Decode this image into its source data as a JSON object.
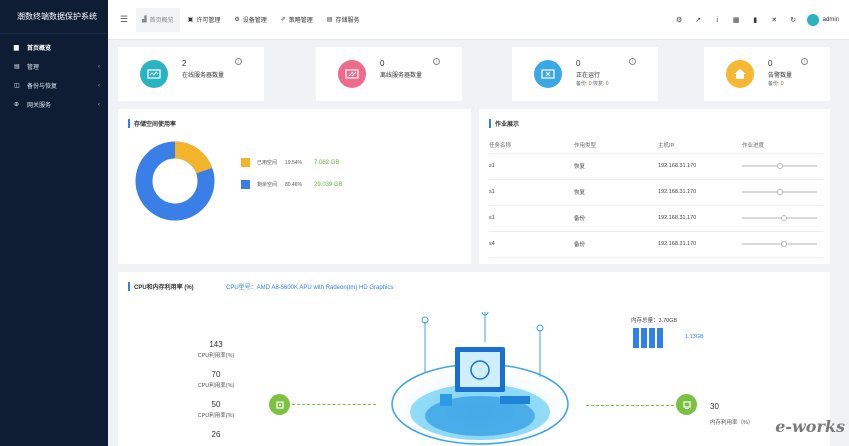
{
  "app": {
    "title": "潮数终端数据保护系统"
  },
  "sidebar": {
    "items": [
      {
        "icon": "▆",
        "label": "首页概览",
        "chevron": ""
      },
      {
        "icon": "▤",
        "label": "管理",
        "chevron": "‹"
      },
      {
        "icon": "◫",
        "label": "备份与恢复",
        "chevron": "‹"
      },
      {
        "icon": "⊕",
        "label": "网关服务",
        "chevron": "‹"
      }
    ]
  },
  "topbar": {
    "menu_icon": "☰",
    "tabs": [
      {
        "icon": "▟",
        "label": "首页概览"
      },
      {
        "icon": "▣",
        "label": "许可管理"
      },
      {
        "icon": "⚙",
        "label": "设备管理"
      },
      {
        "icon": "✐",
        "label": "策略管理"
      },
      {
        "icon": "▤",
        "label": "存储服务"
      }
    ],
    "icons": [
      "⚙",
      "↗",
      "i",
      "▦",
      "▮",
      "✕",
      "↻"
    ],
    "user": "admin"
  },
  "stats": [
    {
      "num": "2",
      "label": "在线服务器数量",
      "sub": "",
      "color": "#2ab3c0"
    },
    {
      "num": "0",
      "label": "离线服务器数量",
      "sub": "",
      "color": "#f06a8c"
    },
    {
      "num": "0",
      "label": "正在运行",
      "sub_prefix": "备份: ",
      "sub_a": "0",
      "sub_mid": " 恢复: ",
      "sub_b": "0",
      "color": "#3ba8e6"
    },
    {
      "num": "0",
      "label": "告警数量",
      "sub_prefix": "备份: ",
      "sub_a": "0",
      "color": "#f7b733"
    }
  ],
  "info_mark": "!",
  "storage": {
    "title": "存储空间使用率",
    "used": {
      "label": "已用空间",
      "pct": "19.54%",
      "size": "7.062 GB",
      "color": "#f3b42c"
    },
    "free": {
      "label": "剩余空间",
      "pct": "80.46%",
      "size": "29.039 GB",
      "color": "#3a7ee8"
    },
    "used_fraction": 0.1954
  },
  "jobs": {
    "title": "作业展示",
    "headers": [
      "任务名称",
      "作用类型",
      "主机IP",
      "作业进度"
    ],
    "rows": [
      {
        "name": "s1",
        "type": "恢复",
        "ip": "192.168.31.170",
        "progress": 0.5
      },
      {
        "name": "s1",
        "type": "恢复",
        "ip": "192.168.31.170",
        "progress": 0.5
      },
      {
        "name": "s1",
        "type": "备份",
        "ip": "192.168.31.170",
        "progress": 0.56
      },
      {
        "name": "s4",
        "type": "备份",
        "ip": "192.168.31.170",
        "progress": 0.56
      }
    ]
  },
  "cpu": {
    "title": "CPU和内存利用率 (%)",
    "model": "CPU型号：AMD A8-5600K APU with Radeon(tm) HD Graphics",
    "metrics": [
      {
        "num": "143",
        "label": "CPU利用率(%)"
      },
      {
        "num": "70",
        "label": "CPU利用率(%)"
      },
      {
        "num": "50",
        "label": "CPU利用率(%)"
      },
      {
        "num": "26",
        "label": ""
      }
    ],
    "mem_total": "内存总量：3.70GB",
    "mem_value": "1.13GB",
    "right_num": "30",
    "right_label": "内存利用率（%）"
  },
  "watermark": "e-works"
}
